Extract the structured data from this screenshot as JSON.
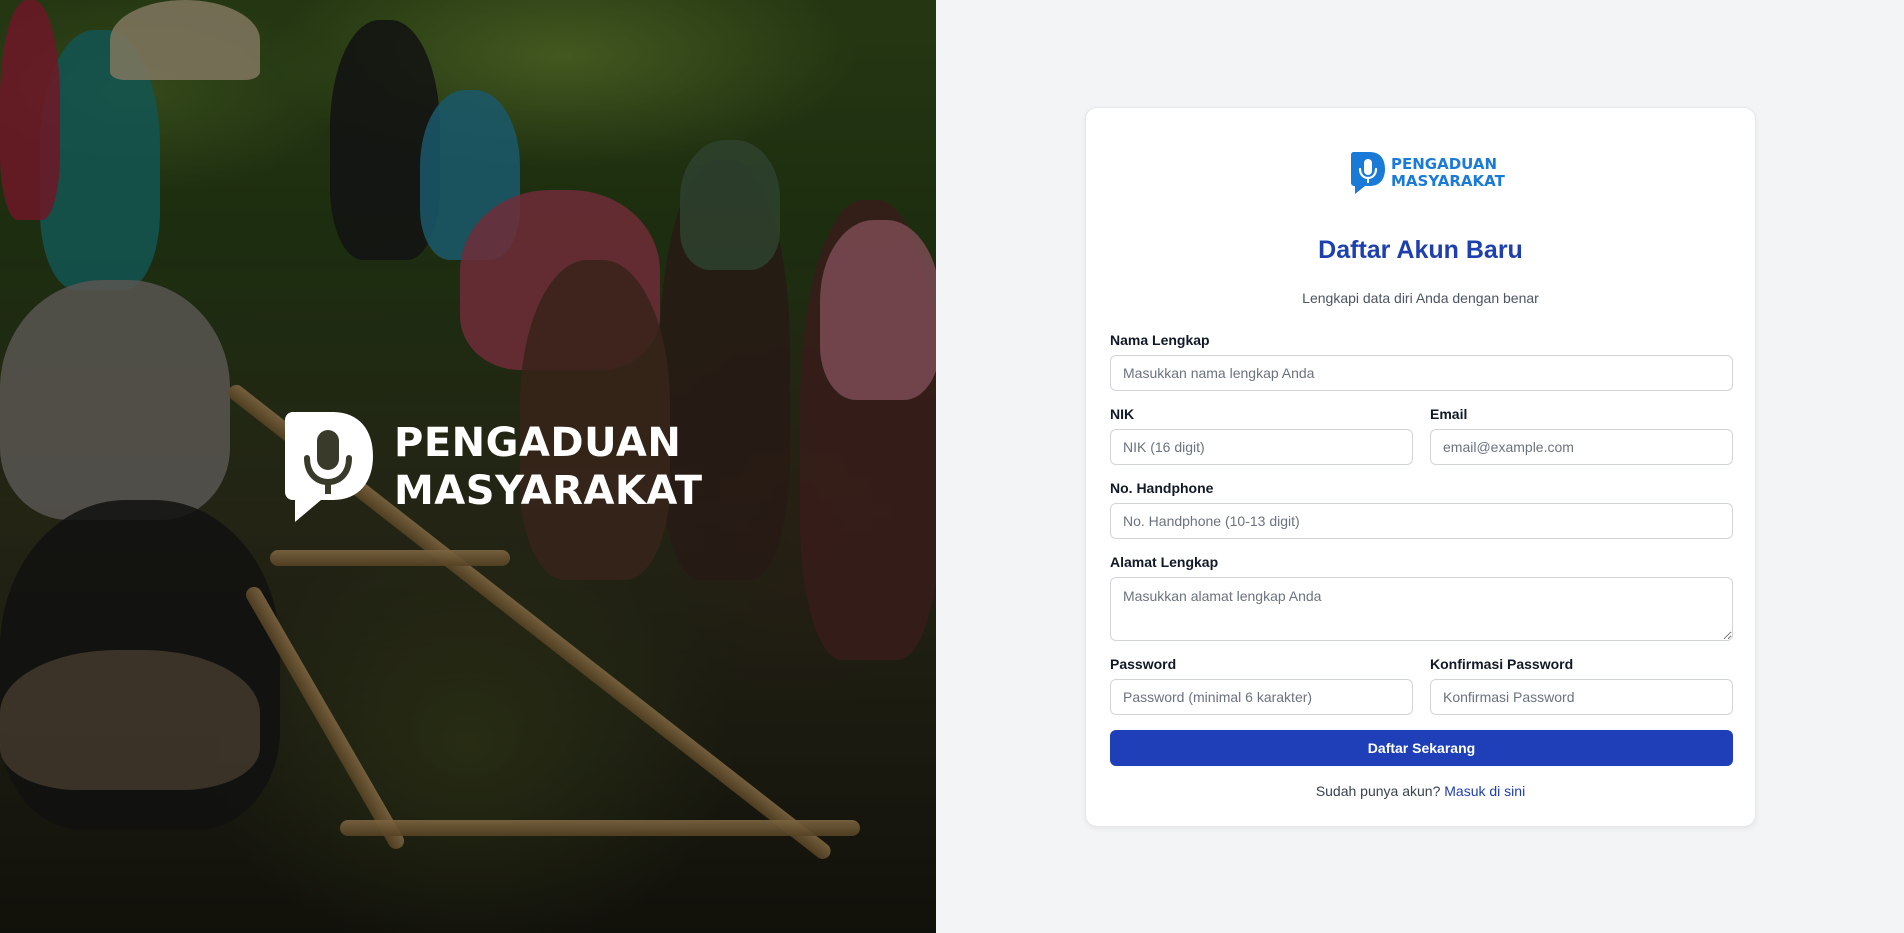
{
  "brand": {
    "line1": "PENGADUAN",
    "line2": "MASYARAKAT"
  },
  "form": {
    "title": "Daftar Akun Baru",
    "subtitle": "Lengkapi data diri Anda dengan benar",
    "nama": {
      "label": "Nama Lengkap",
      "placeholder": "Masukkan nama lengkap Anda",
      "value": ""
    },
    "nik": {
      "label": "NIK",
      "placeholder": "NIK (16 digit)",
      "value": ""
    },
    "email": {
      "label": "Email",
      "placeholder": "email@example.com",
      "value": ""
    },
    "phone": {
      "label": "No. Handphone",
      "placeholder": "No. Handphone (10-13 digit)",
      "value": ""
    },
    "alamat": {
      "label": "Alamat Lengkap",
      "placeholder": "Masukkan alamat lengkap Anda",
      "value": ""
    },
    "password": {
      "label": "Password",
      "placeholder": "Password (minimal 6 karakter)",
      "value": ""
    },
    "confirm": {
      "label": "Konfirmasi Password",
      "placeholder": "Konfirmasi Password",
      "value": ""
    },
    "submit_label": "Daftar Sekarang",
    "footer_text": "Sudah punya akun?",
    "login_link": "Masuk di sini"
  },
  "colors": {
    "primary": "#1e3fb8",
    "title": "#1e40af",
    "logo_blue": "#1a7ad8",
    "background": "#f3f4f6"
  },
  "hero": {
    "image": "farmers-in-rice-field-photo"
  }
}
